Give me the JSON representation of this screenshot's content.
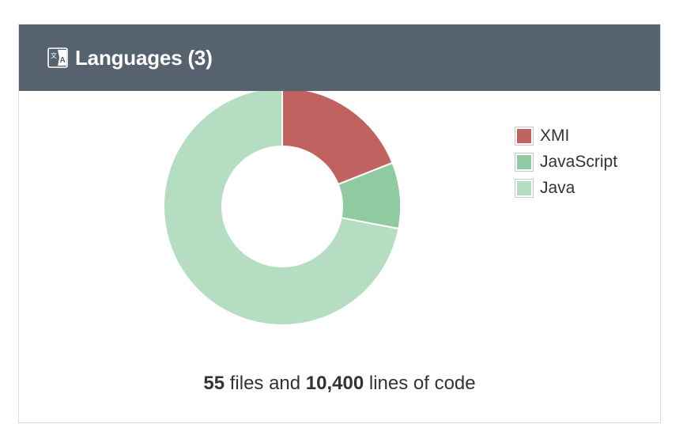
{
  "header": {
    "title": "Languages (3)",
    "icon": "translate-icon",
    "background": "#56636f"
  },
  "chart_data": {
    "type": "pie",
    "variant": "donut",
    "categories": [
      "XMI",
      "JavaScript",
      "Java"
    ],
    "values": [
      19,
      9,
      72
    ],
    "colors": [
      "#c0625f",
      "#8fcaa1",
      "#b4ddc2"
    ],
    "legend_position": "right"
  },
  "summary": {
    "files_count": "55",
    "files_text": " files and ",
    "lines_count": "10,400",
    "lines_text": " lines of code"
  }
}
